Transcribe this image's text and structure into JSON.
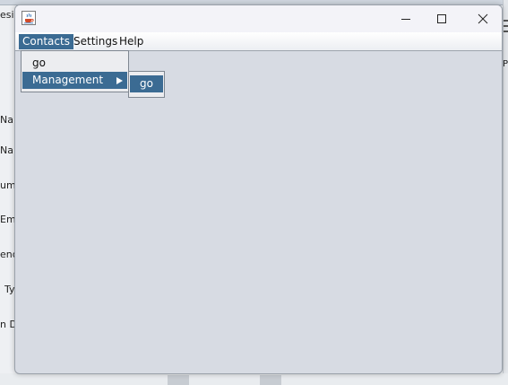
{
  "background": {
    "tab_text": "esig",
    "form_labels": [
      "Nar",
      "Nar",
      "umb",
      "Em",
      "end",
      "Ty",
      "n Da"
    ],
    "right_text": "Pa"
  },
  "window": {
    "icon": "java-coffee-icon",
    "controls": {
      "minimize": "minimize-icon",
      "maximize": "maximize-icon",
      "close": "close-icon"
    }
  },
  "menubar": {
    "contacts": "Contacts",
    "settings": "Settings",
    "help": "Help"
  },
  "contacts_menu": {
    "items": [
      {
        "label": "go"
      },
      {
        "label": "Management"
      }
    ],
    "management_submenu": {
      "items": [
        {
          "label": "go"
        }
      ]
    }
  },
  "colors": {
    "selection": "#3b6b93",
    "window_bg": "#d7dbe3",
    "menu_bg": "#ecedf0"
  }
}
